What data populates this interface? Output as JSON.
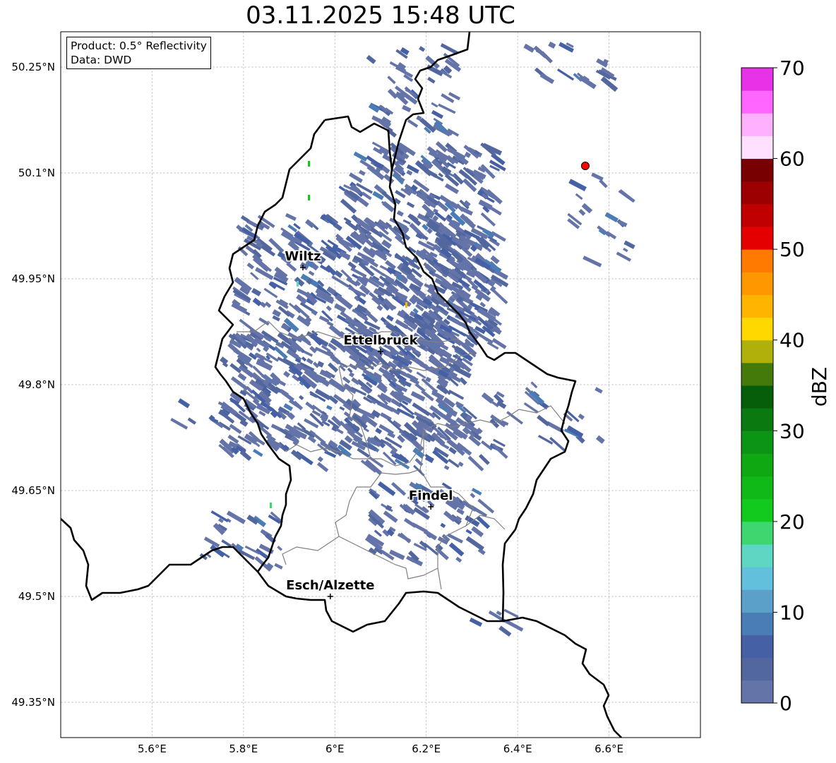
{
  "title": "03.11.2025 15:48 UTC",
  "info": {
    "product": "Product: 0.5° Reflectivity",
    "data": "Data: DWD"
  },
  "map": {
    "extent_lon": [
      5.4,
      6.8
    ],
    "extent_lat": [
      49.3,
      50.3
    ],
    "lon_ticks": [
      "5.6°E",
      "5.8°E",
      "6°E",
      "6.2°E",
      "6.4°E",
      "6.6°E"
    ],
    "lat_ticks": [
      "50.25°N",
      "50.1°N",
      "49.95°N",
      "49.8°N",
      "49.65°N",
      "49.5°N",
      "49.35°N"
    ],
    "gridlines": true,
    "cities": [
      {
        "name": "Wiltz",
        "lon": 5.93,
        "lat": 49.966
      },
      {
        "name": "Ettelbruck",
        "lon": 6.1,
        "lat": 49.847
      },
      {
        "name": "Findel",
        "lon": 6.21,
        "lat": 49.627
      },
      {
        "name": "Esch/Alzette",
        "lon": 5.99,
        "lat": 49.5
      }
    ],
    "radar_site": {
      "lon": 6.548,
      "lat": 50.11,
      "color": "#ff0000"
    }
  },
  "colorbar": {
    "label": "dBZ",
    "min": 0,
    "max": 70,
    "step": 2.5,
    "ticks": [
      "0",
      "10",
      "20",
      "30",
      "40",
      "50",
      "60",
      "70"
    ],
    "colors": [
      "#6474a8",
      "#53679f",
      "#4560a5",
      "#4a7db5",
      "#5aa0c8",
      "#62c0dc",
      "#5fd6c4",
      "#3ed66f",
      "#12c91e",
      "#10b818",
      "#10a812",
      "#0c9514",
      "#0a7a10",
      "#065e0a",
      "#437a0a",
      "#afb00a",
      "#ffd800",
      "#ffb400",
      "#ff9800",
      "#ff7a00",
      "#e40000",
      "#c00000",
      "#9c0000",
      "#780000",
      "#ffe0ff",
      "#ffb0ff",
      "#ff66ff",
      "#e832e8"
    ]
  }
}
